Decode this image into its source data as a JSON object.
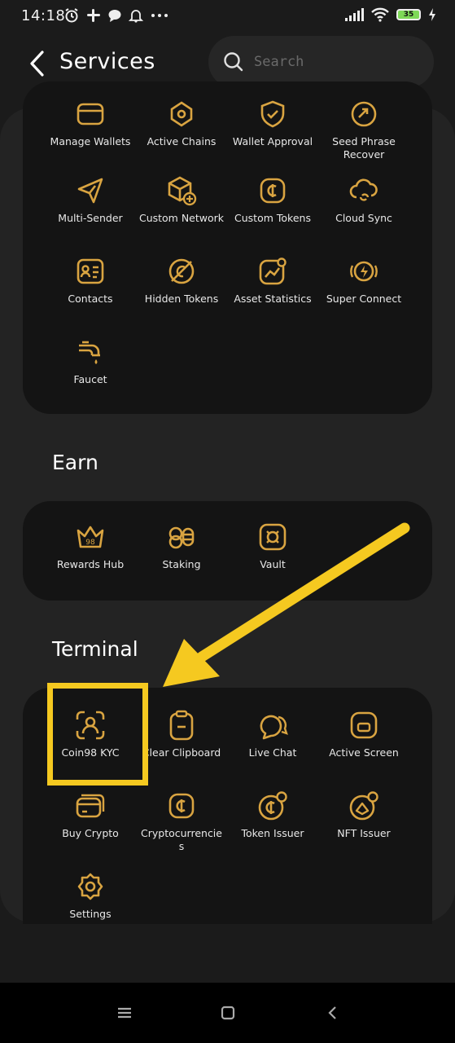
{
  "status_bar": {
    "time": "14:18",
    "battery": "35"
  },
  "header": {
    "title": "Services",
    "search_placeholder": "Search"
  },
  "colors": {
    "accent": "#d9a441",
    "highlight": "#f5c920"
  },
  "sections": {
    "tools": {
      "items": [
        {
          "label": "Manage Wallets",
          "icon": "wallet-icon"
        },
        {
          "label": "Active Chains",
          "icon": "chain-icon"
        },
        {
          "label": "Wallet Approval",
          "icon": "shield-check-icon"
        },
        {
          "label": "Seed Phrase Recover",
          "icon": "recover-icon"
        },
        {
          "label": "Multi-Sender",
          "icon": "send-icon"
        },
        {
          "label": "Custom Network",
          "icon": "cube-add-icon"
        },
        {
          "label": "Custom Tokens",
          "icon": "token-icon"
        },
        {
          "label": "Cloud Sync",
          "icon": "cloud-sync-icon"
        },
        {
          "label": "Contacts",
          "icon": "contacts-icon"
        },
        {
          "label": "Hidden Tokens",
          "icon": "hidden-token-icon"
        },
        {
          "label": "Asset Statistics",
          "icon": "chart-icon"
        },
        {
          "label": "Super Connect",
          "icon": "lightning-icon"
        },
        {
          "label": "Faucet",
          "icon": "faucet-icon"
        }
      ]
    },
    "earn": {
      "title": "Earn",
      "items": [
        {
          "label": "Rewards Hub",
          "icon": "crown-icon"
        },
        {
          "label": "Staking",
          "icon": "coins-icon"
        },
        {
          "label": "Vault",
          "icon": "vault-icon"
        }
      ]
    },
    "terminal": {
      "title": "Terminal",
      "items": [
        {
          "label": "Coin98 KYC",
          "icon": "kyc-icon"
        },
        {
          "label": "Clear Clipboard",
          "icon": "clipboard-icon"
        },
        {
          "label": "Live Chat",
          "icon": "chat-icon"
        },
        {
          "label": "Active Screen",
          "icon": "screen-icon"
        },
        {
          "label": "Buy Crypto",
          "icon": "card-icon"
        },
        {
          "label": "Cryptocurrencies",
          "icon": "token-icon"
        },
        {
          "label": "Token Issuer",
          "icon": "token-issuer-icon"
        },
        {
          "label": "NFT Issuer",
          "icon": "nft-issuer-icon"
        },
        {
          "label": "Settings",
          "icon": "settings-icon"
        }
      ]
    }
  }
}
